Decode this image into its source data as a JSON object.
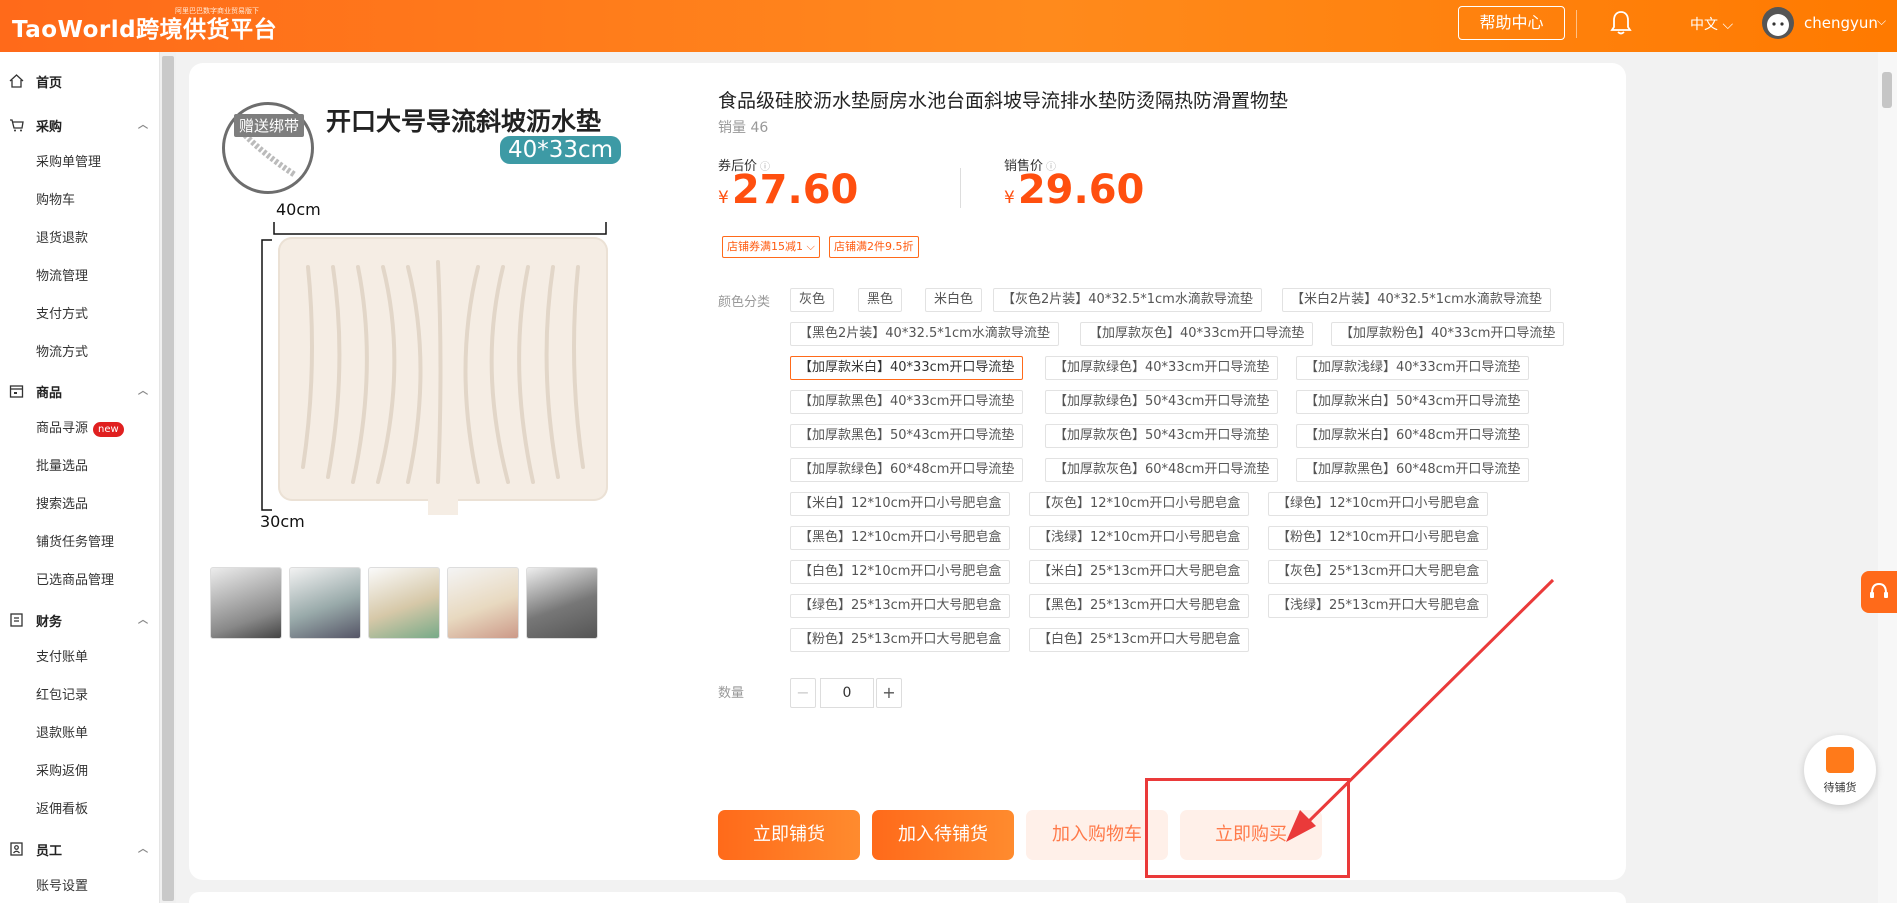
{
  "header": {
    "logo": "TaoWorld跨境供货平台",
    "logo_tagline": "阿里巴巴数字商业贸易版下",
    "help_button": "帮助中心",
    "language": "中文",
    "username": "chengyun"
  },
  "sidebar": {
    "sections": [
      {
        "label": "首页",
        "icon": "home-icon",
        "items": []
      },
      {
        "label": "采购",
        "icon": "cart-icon",
        "items": [
          "采购单管理",
          "购物车",
          "退货退款",
          "物流管理",
          "支付方式",
          "物流方式"
        ]
      },
      {
        "label": "商品",
        "icon": "store-icon",
        "items": [
          "商品寻源",
          "批量选品",
          "搜索选品",
          "铺货任务管理",
          "已选商品管理"
        ]
      },
      {
        "label": "财务",
        "icon": "finance-icon",
        "items": [
          "支付账单",
          "红包记录",
          "退款账单",
          "采购返佣",
          "返佣看板"
        ]
      },
      {
        "label": "员工",
        "icon": "staff-icon",
        "items": [
          "账号设置"
        ]
      }
    ],
    "new_badge": "new"
  },
  "product": {
    "image_overlay": {
      "gift_label": "赠送绑带",
      "title": "开口大号导流斜坡沥水垫",
      "size": "40*33cm",
      "width_label": "40cm",
      "height_label": "30cm"
    },
    "title": "食品级硅胶沥水垫厨房水池台面斜坡导流排水垫防烫隔热防滑置物垫",
    "sales": "销量 46",
    "coupon_price_label": "券后价",
    "coupon_price": "27.60",
    "sale_price_label": "销售价",
    "sale_price": "29.60",
    "currency": "¥",
    "info_icon": "info-icon",
    "promo_tags": [
      "店铺券满15减1",
      "店铺满2件9.5折"
    ],
    "options_label": "颜色分类",
    "options": [
      "灰色",
      "黑色",
      "米白色",
      "【灰色2片装】40*32.5*1cm水滴款导流垫",
      "【米白2片装】40*32.5*1cm水滴款导流垫",
      "【黑色2片装】40*32.5*1cm水滴款导流垫",
      "【加厚款灰色】40*33cm开口导流垫",
      "【加厚款粉色】40*33cm开口导流垫",
      "【加厚款米白】40*33cm开口导流垫",
      "【加厚款绿色】40*33cm开口导流垫",
      "【加厚款浅绿】40*33cm开口导流垫",
      "【加厚款黑色】40*33cm开口导流垫",
      "【加厚款绿色】50*43cm开口导流垫",
      "【加厚款米白】50*43cm开口导流垫",
      "【加厚款黑色】50*43cm开口导流垫",
      "【加厚款灰色】50*43cm开口导流垫",
      "【加厚款米白】60*48cm开口导流垫",
      "【加厚款绿色】60*48cm开口导流垫",
      "【加厚款灰色】60*48cm开口导流垫",
      "【加厚款黑色】60*48cm开口导流垫",
      "【米白】12*10cm开口小号肥皂盒",
      "【灰色】12*10cm开口小号肥皂盒",
      "【绿色】12*10cm开口小号肥皂盒",
      "【黑色】12*10cm开口小号肥皂盒",
      "【浅绿】12*10cm开口小号肥皂盒",
      "【粉色】12*10cm开口小号肥皂盒",
      "【白色】12*10cm开口小号肥皂盒",
      "【米白】25*13cm开口大号肥皂盒",
      "【灰色】25*13cm开口大号肥皂盒",
      "【绿色】25*13cm开口大号肥皂盒",
      "【黑色】25*13cm开口大号肥皂盒",
      "【浅绿】25*13cm开口大号肥皂盒",
      "【粉色】25*13cm开口大号肥皂盒",
      "【白色】25*13cm开口大号肥皂盒"
    ],
    "selected_option": "【加厚款米白】40*33cm开口导流垫",
    "quantity_label": "数量",
    "quantity": "0",
    "minus": "−",
    "plus": "+"
  },
  "actions": {
    "distribute_now": "立即铺货",
    "add_pending": "加入待铺货",
    "add_cart": "加入购物车",
    "buy_now": "立即购买"
  },
  "float_cart": {
    "label": "待铺货"
  },
  "colors": {
    "brand": "#ff6a1a",
    "price": "#ff4f0f",
    "highlight_box": "#ea3a3a"
  }
}
